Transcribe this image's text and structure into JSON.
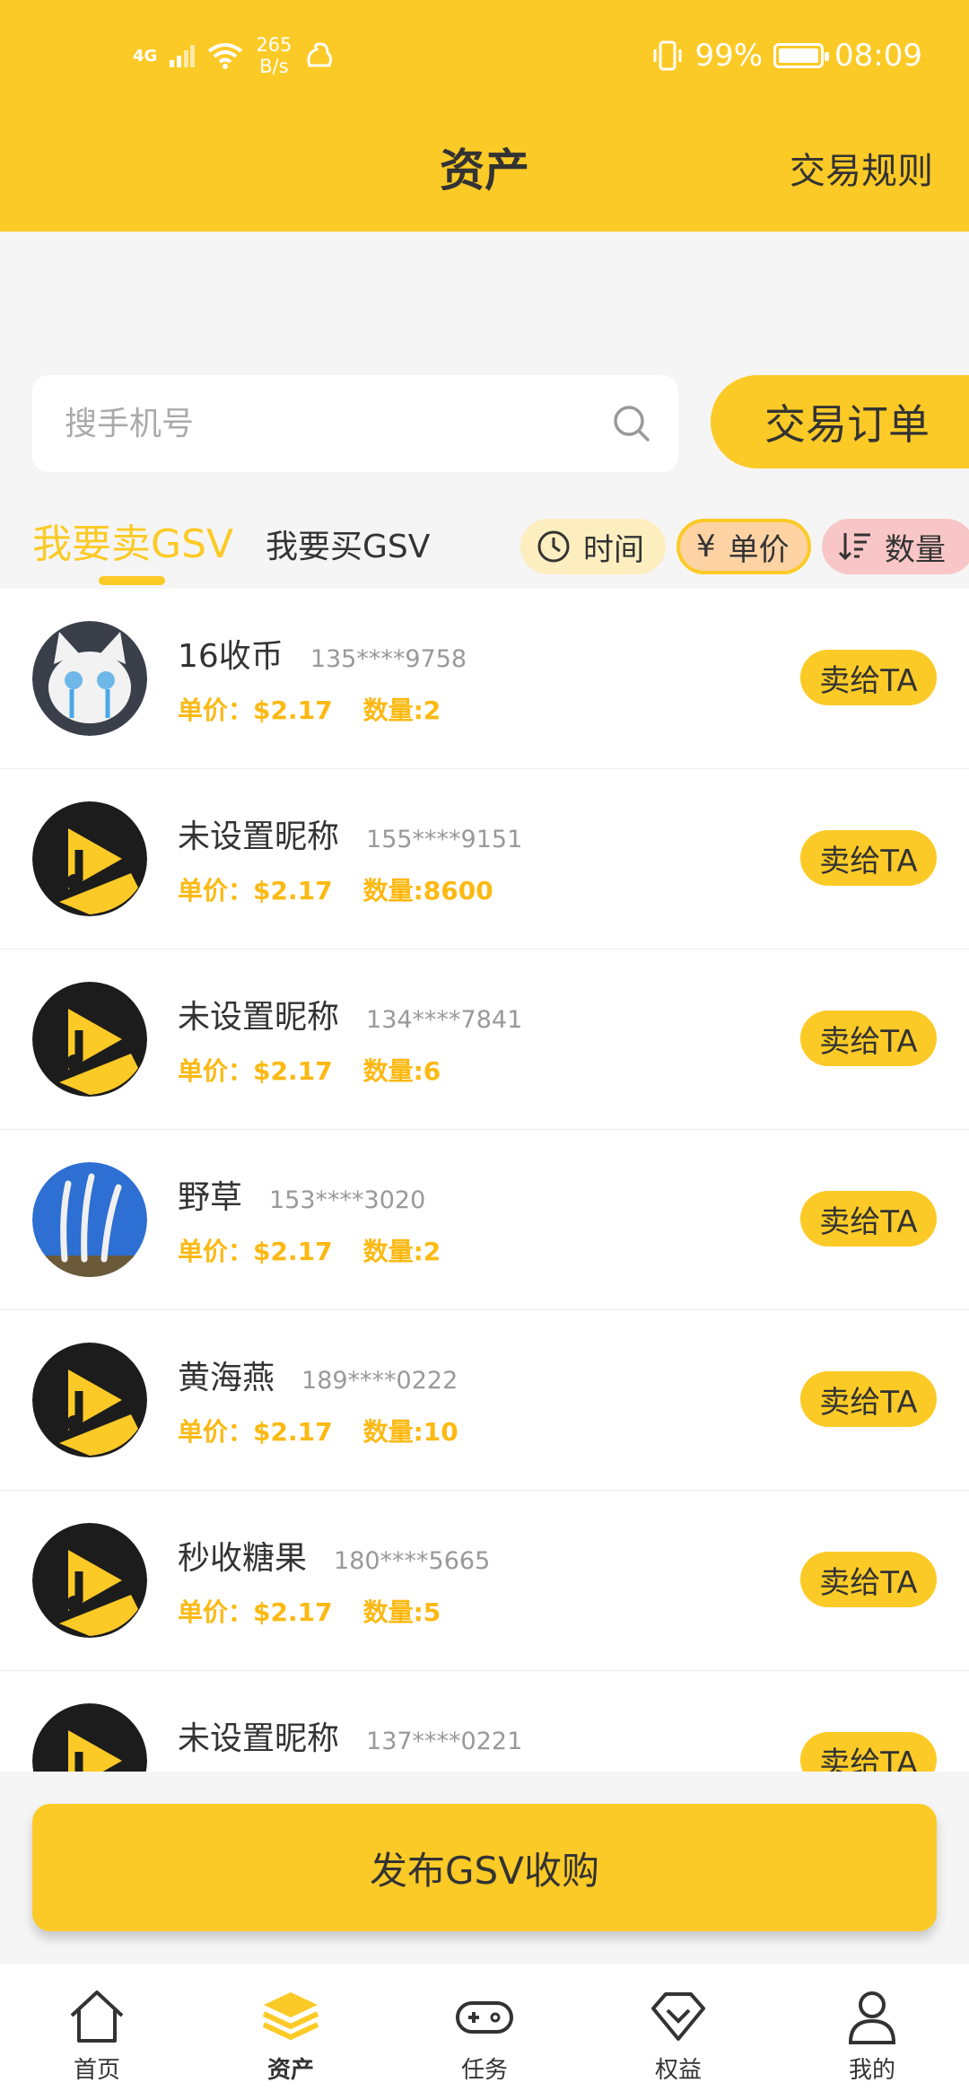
{
  "status_bar": {
    "network": "4G",
    "speed_value": "265",
    "speed_unit": "B/s",
    "battery": "99%",
    "battery_level": 0.99,
    "time": "08:09"
  },
  "header": {
    "title": "资产",
    "rules_link": "交易规则"
  },
  "search": {
    "placeholder": "搜手机号",
    "value": "",
    "orders_button": "交易订单"
  },
  "tabs": {
    "sell": "我要卖GSV",
    "buy": "我要买GSV"
  },
  "filters": {
    "time": "时间",
    "price_symbol": "¥",
    "price": "单价",
    "quantity": "数量"
  },
  "list_labels": {
    "price_prefix": "单价:",
    "qty_prefix": "数量:",
    "sell_button": "卖给TA"
  },
  "rows": [
    {
      "name": "16收币",
      "phone": "135****9758",
      "price": "单价：$2.17",
      "qty": "数量:2",
      "avatar": "cat"
    },
    {
      "name": "未设置昵称",
      "phone": "155****9151",
      "price": "单价：$2.17",
      "qty": "数量:8600",
      "avatar": "logo"
    },
    {
      "name": "未设置昵称",
      "phone": "134****7841",
      "price": "单价：$2.17",
      "qty": "数量:6",
      "avatar": "logo"
    },
    {
      "name": "野草",
      "phone": "153****3020",
      "price": "单价：$2.17",
      "qty": "数量:2",
      "avatar": "grass"
    },
    {
      "name": "黄海燕",
      "phone": "189****0222",
      "price": "单价：$2.17",
      "qty": "数量:10",
      "avatar": "logo"
    },
    {
      "name": "秒收糖果",
      "phone": "180****5665",
      "price": "单价：$2.17",
      "qty": "数量:5",
      "avatar": "logo"
    },
    {
      "name": "未设置昵称",
      "phone": "137****0221",
      "price": "",
      "qty": "",
      "avatar": "logo"
    }
  ],
  "publish_button": "发布GSV收购",
  "bottom_nav": [
    {
      "label": "首页",
      "icon": "home-icon"
    },
    {
      "label": "资产",
      "icon": "layers-icon"
    },
    {
      "label": "任务",
      "icon": "gamepad-icon"
    },
    {
      "label": "权益",
      "icon": "shield-check-icon"
    },
    {
      "label": "我的",
      "icon": "user-icon"
    }
  ],
  "colors": {
    "accent": "#fcca26",
    "price_text": "#fcb912",
    "background": "#f5f5f5"
  }
}
